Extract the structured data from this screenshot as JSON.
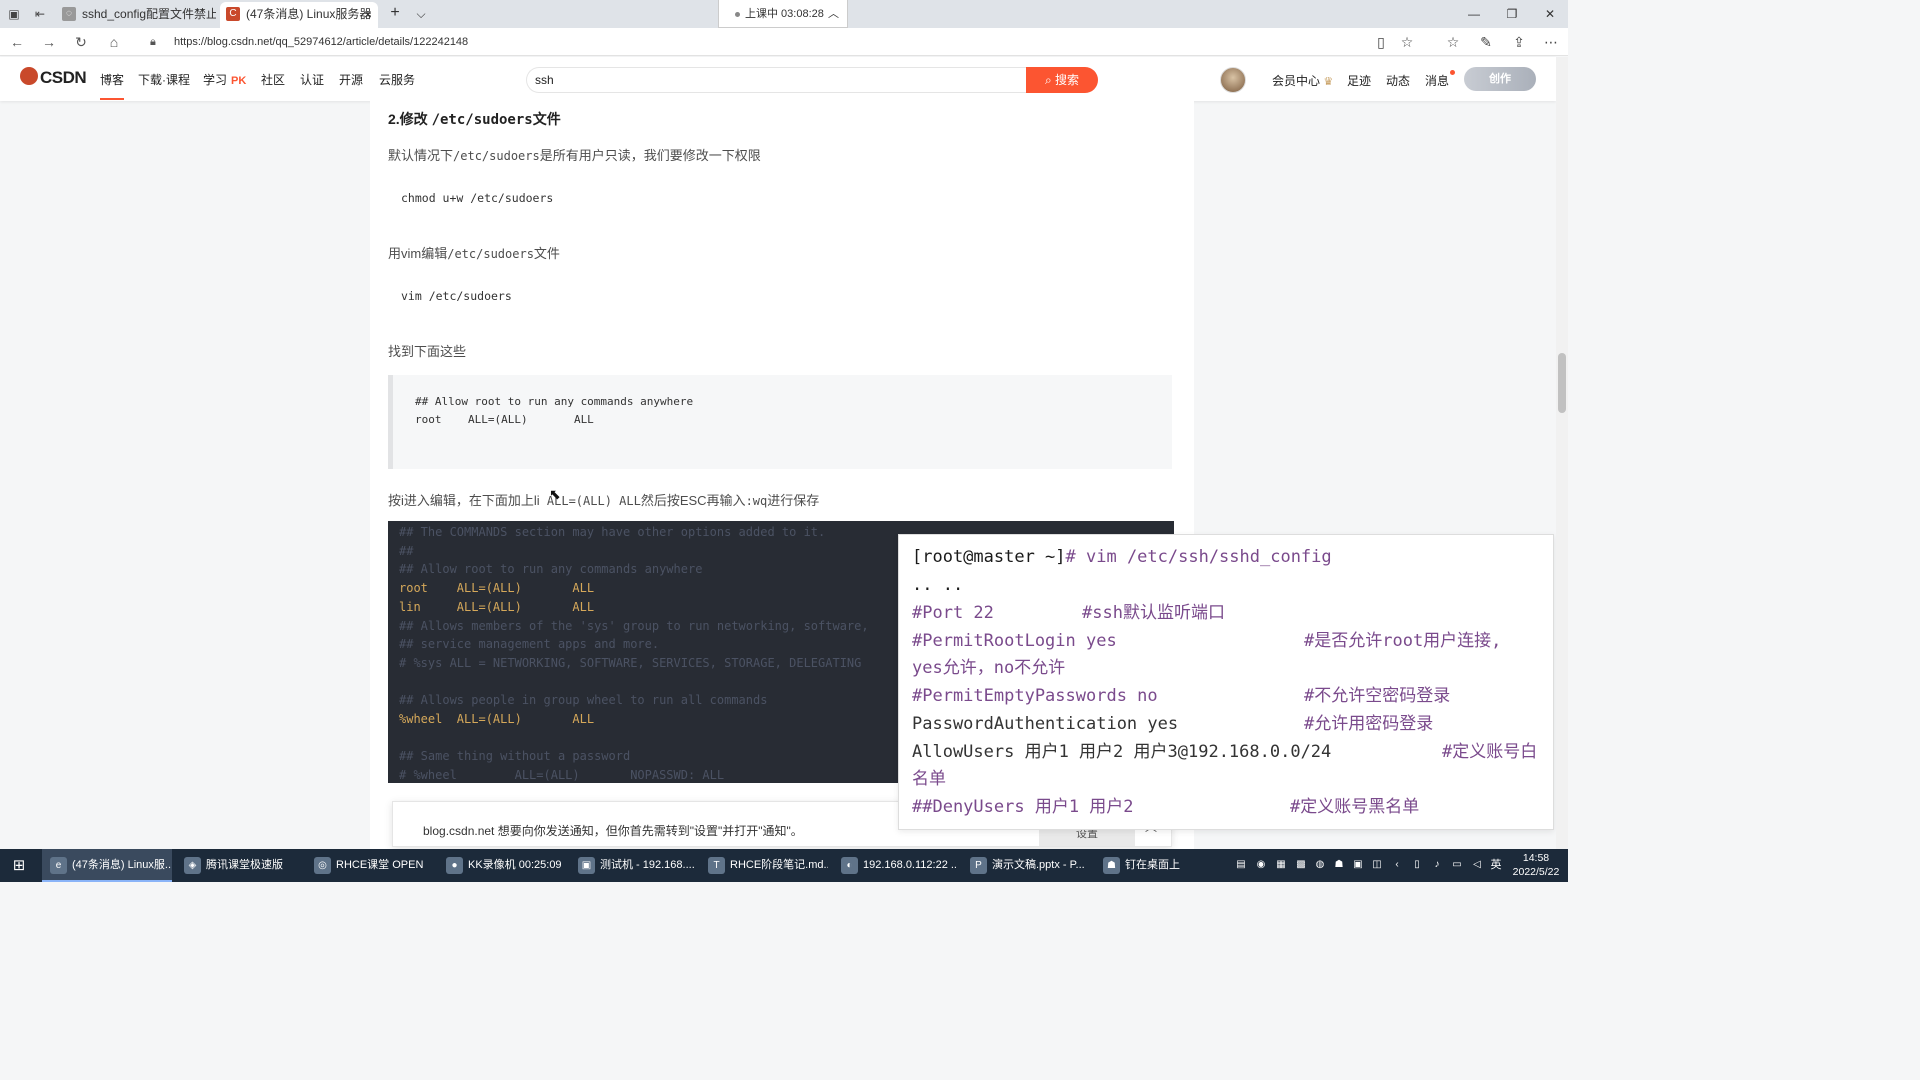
{
  "browser": {
    "tabs": [
      {
        "label": "sshd_config配置文件禁止ro",
        "active": false
      },
      {
        "label": "(47条消息) Linux服务器",
        "active": true
      }
    ],
    "recording": {
      "label": "上课中 03:08:28"
    },
    "url": "https://blog.csdn.net/qq_52974612/article/details/122242148"
  },
  "csdn": {
    "logo": "CSDN",
    "nav": [
      "博客",
      "下载·课程",
      "学习",
      "社区",
      "认证",
      "开源",
      "云服务"
    ],
    "pk_label": "PK",
    "search": {
      "value": "ssh",
      "button": "搜索"
    },
    "right_links": [
      "会员中心",
      "足迹",
      "动态",
      "消息"
    ],
    "create_label": "创作"
  },
  "article": {
    "heading_prefix": "2.修改 ",
    "heading_code": "/etc/sudoers",
    "heading_suffix": "文件",
    "p1_a": "默认情况下",
    "p1_code": "/etc/sudoers",
    "p1_b": "是所有用户只读，我们要修改一下权限",
    "code1": "chmod u+w /etc/sudoers",
    "p2_a": "用vim编辑",
    "p2_code": "/etc/sudoers",
    "p2_b": "文件",
    "code2": "vim /etc/sudoers",
    "p3": "找到下面这些",
    "quote_line1": "## Allow root to run any commands anywhere",
    "quote_line2": "root    ALL=(ALL)       ALL",
    "p4_a": "按i进入编辑，在下面加上li",
    "p4_code": " ALL=(ALL) ALL",
    "p4_b": "然后按ESC再输入",
    "p4_code2": ":wq",
    "p4_c": "进行保存",
    "dark_lines": [
      {
        "text": "## The COMMANDS section may have other options added to it.",
        "lit": false
      },
      {
        "text": "##",
        "lit": false
      },
      {
        "text": "## Allow root to run any commands anywhere",
        "lit": false
      },
      {
        "text": "root    ALL=(ALL)       ALL",
        "lit": true
      },
      {
        "text": "lin     ALL=(ALL)       ALL",
        "lit": true
      },
      {
        "text": "## Allows members of the 'sys' group to run networking, software,",
        "lit": false
      },
      {
        "text": "## service management apps and more.",
        "lit": false
      },
      {
        "text": "# %sys ALL = NETWORKING, SOFTWARE, SERVICES, STORAGE, DELEGATING",
        "lit": false
      },
      {
        "text": "",
        "lit": false
      },
      {
        "text": "## Allows people in group wheel to run all commands",
        "lit": false
      },
      {
        "text": "%wheel  ALL=(ALL)       ALL",
        "lit": true
      },
      {
        "text": "",
        "lit": false
      },
      {
        "text": "## Same thing without a password",
        "lit": false
      },
      {
        "text": "# %wheel        ALL=(ALL)       NOPASSWD: ALL",
        "lit": false
      }
    ]
  },
  "notification": {
    "message": "blog.csdn.net 想要向你发送通知，但你首先需转到\"设置\"并打开\"通知\"。",
    "button": "设置"
  },
  "terminal": {
    "l1_prompt": "[root@master ~]",
    "l1_cmd": "# vim /etc/ssh/sshd_config",
    "l2": ".. ..",
    "l3_a": "#Port 22",
    "l3_b": "#ssh默认监听端口",
    "l4_a": "#PermitRootLogin yes",
    "l4_b": "#是否允许root用户连接,",
    "l5": "yes允许，no不允许",
    "l6_a": "#PermitEmptyPasswords no",
    "l6_b": "#不允许空密码登录",
    "l7_a": "PasswordAuthentication yes",
    "l7_b": "#允许用密码登录",
    "l8_a": "AllowUsers  用户1  用户2    用户3@192.168.0.0/24",
    "l8_b": "#定义账号白",
    "l9": "名单",
    "l10_a": "##DenyUsers 用户1  用户2",
    "l10_b": "#定义账号黑名单"
  },
  "taskbar": {
    "items": [
      {
        "label": "(47条消息) Linux服...",
        "icon": "edge-icon"
      },
      {
        "label": "腾讯课堂极速版",
        "icon": "tencent-class-icon"
      },
      {
        "label": "RHCE课堂 OPEN",
        "icon": "classroom-icon"
      },
      {
        "label": "KK录像机 00:25:09",
        "icon": "recorder-icon"
      },
      {
        "label": "测试机 - 192.168....",
        "icon": "vm-icon"
      },
      {
        "label": "RHCE阶段笔记.md...",
        "icon": "typora-icon"
      },
      {
        "label": "192.168.0.112:22 ...",
        "icon": "ssh-client-icon"
      },
      {
        "label": "演示文稿.pptx - P...",
        "icon": "powerpoint-icon"
      },
      {
        "label": "钉在桌面上",
        "icon": "pin-icon"
      }
    ],
    "ime": "英",
    "time": "14:58",
    "date": "2022/5/22"
  }
}
